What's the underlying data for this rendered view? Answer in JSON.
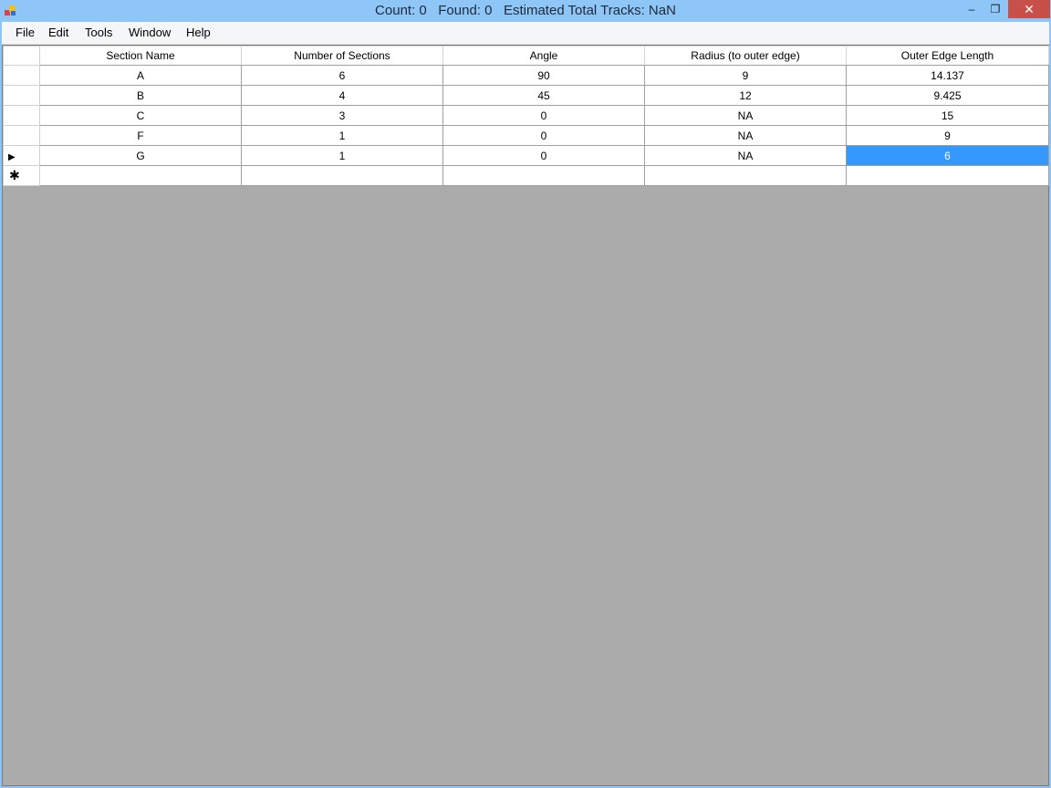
{
  "window": {
    "title": "Count: 0   Found: 0   Estimated Total Tracks: NaN",
    "icons": {
      "app": "app-icon",
      "minimize": "minimize-icon",
      "restore": "restore-icon",
      "close": "close-icon"
    },
    "colors": {
      "titlebar": "#8ec6f7",
      "close_button": "#c7504a",
      "selection": "#3399ff"
    }
  },
  "menu": {
    "items": [
      "File",
      "Edit",
      "Tools",
      "Window",
      "Help"
    ]
  },
  "grid": {
    "columns": [
      "Section Name",
      "Number of Sections",
      "Angle",
      "Radius (to outer edge)",
      "Outer Edge Length"
    ],
    "rows": [
      [
        "A",
        "6",
        "90",
        "9",
        "14.137"
      ],
      [
        "B",
        "4",
        "45",
        "12",
        "9.425"
      ],
      [
        "C",
        "3",
        "0",
        "NA",
        "15"
      ],
      [
        "F",
        "1",
        "0",
        "NA",
        "9"
      ],
      [
        "G",
        "1",
        "0",
        "NA",
        "6"
      ]
    ],
    "current_row_marker": "▶",
    "new_row_marker": "✱",
    "current_row_icon": "current-row-arrow-icon",
    "new_row_icon": "new-row-asterisk-icon"
  }
}
